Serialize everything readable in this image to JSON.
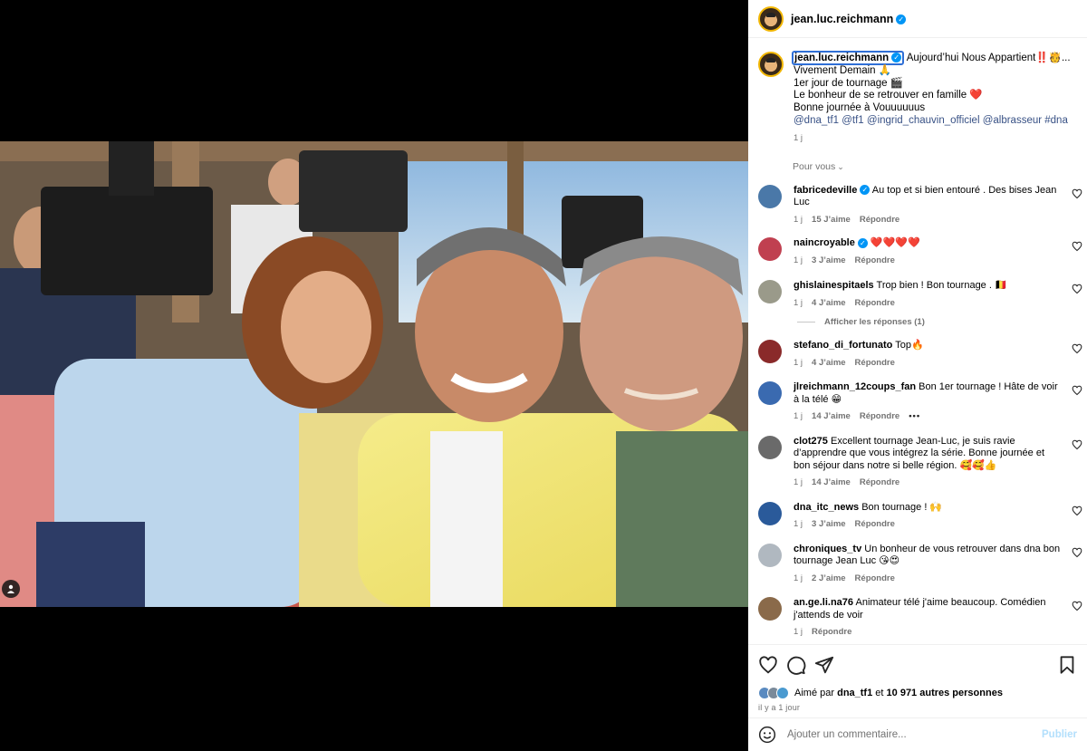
{
  "post": {
    "username": "jean.luc.reichmann",
    "caption_lines": [
      "Aujourd’hui Nous Appartient‼️🫅...",
      "Vivement Demain 🙏",
      "1er jour de tournage 🎬",
      "Le bonheur de se retrouver en famille ❤️",
      "Bonne journée à Vouuuuuus"
    ],
    "caption_tags": "@dna_tf1 @tf1 @ingrid_chauvin_officiel @albrasseur #dna",
    "caption_time": "1 j",
    "for_you_label": "Pour vous"
  },
  "comments": [
    {
      "user": "fabricedeville",
      "verified": true,
      "text": "Au top et si bien entouré . Des bises Jean Luc",
      "time": "1 j",
      "likes": "15 J’aime",
      "reply": "Répondre",
      "avatar": "#4a78a8"
    },
    {
      "user": "naincroyable",
      "verified": true,
      "text": "❤️❤️❤️❤️",
      "time": "1 j",
      "likes": "3 J’aime",
      "reply": "Répondre",
      "avatar": "#c04050"
    },
    {
      "user": "ghislainespitaels",
      "verified": false,
      "text": "Trop bien ! Bon tournage . 🇧🇪",
      "time": "1 j",
      "likes": "4 J’aime",
      "reply": "Répondre",
      "avatar": "#9a9a8a",
      "show_replies": "Afficher les réponses (1)"
    },
    {
      "user": "stefano_di_fortunato",
      "verified": false,
      "text": "Top🔥",
      "time": "1 j",
      "likes": "4 J’aime",
      "reply": "Répondre",
      "avatar": "#8a2a2a"
    },
    {
      "user": "jlreichmann_12coups_fan",
      "verified": false,
      "text": "Bon 1er tournage ! Hâte de voir à la télé 😁",
      "time": "1 j",
      "likes": "14 J’aime",
      "reply": "Répondre",
      "avatar": "#3a6ab0",
      "more": "•••"
    },
    {
      "user": "clot275",
      "verified": false,
      "text": "Excellent tournage Jean-Luc, je suis ravie d’apprendre que vous intégrez la série. Bonne journée et bon séjour dans notre si belle région. 🥰🥰👍",
      "time": "1 j",
      "likes": "14 J’aime",
      "reply": "Répondre",
      "avatar": "#6a6a6a"
    },
    {
      "user": "dna_itc_news",
      "verified": false,
      "text": "Bon tournage ! 🙌",
      "time": "1 j",
      "likes": "3 J’aime",
      "reply": "Répondre",
      "avatar": "#2a5a9a"
    },
    {
      "user": "chroniques_tv",
      "verified": false,
      "text": "Un bonheur de vous retrouver dans dna bon tournage Jean Luc 😘😍",
      "time": "1 j",
      "likes": "2 J’aime",
      "reply": "Répondre",
      "avatar": "#b0b8c0"
    },
    {
      "user": "an.ge.li.na76",
      "verified": false,
      "text": "Animateur télé j'aime beaucoup. Comédien j'attends de voir",
      "time": "1 j",
      "likes": "",
      "reply": "Répondre",
      "avatar": "#8a6a4a"
    }
  ],
  "likes": {
    "prefix": "Aimé par",
    "by": "dna_tf1",
    "and": "et",
    "others": "10 971 autres personnes",
    "time_ago": "il y a 1 jour",
    "avatar_colors": [
      "#5a8ac0",
      "#7a8a9a",
      "#4a9ad0"
    ]
  },
  "composer": {
    "placeholder": "Ajouter un commentaire...",
    "publish": "Publier"
  },
  "colors": {
    "accent": "#0095f6",
    "link": "#385185",
    "like_red": "#ed4956"
  }
}
